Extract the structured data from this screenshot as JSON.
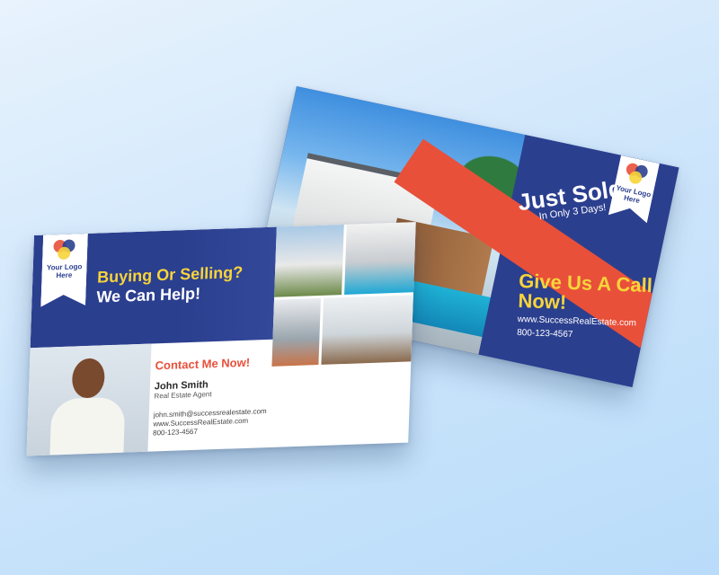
{
  "back_card": {
    "banner_title": "Just Sold",
    "banner_subtitle": "In Only 3 Days!",
    "logo_text": "Your Logo Here",
    "cta_title": "Give Us A Call Now!",
    "website": "www.SuccessRealEstate.com",
    "phone": "800-123-4567"
  },
  "front_card": {
    "logo_text": "Your Logo Here",
    "headline_line1": "Buying Or Selling?",
    "headline_line2": "We Can Help!",
    "contact_title": "Contact Me Now!",
    "agent_name": "John Smith",
    "agent_role": "Real Estate Agent",
    "email": "john.smith@successrealestate.com",
    "website": "www.SuccessRealEstate.com",
    "phone": "800-123-4567"
  },
  "colors": {
    "navy": "#2b3f8f",
    "accent_red": "#e8503a",
    "accent_yellow": "#f7d43a"
  }
}
